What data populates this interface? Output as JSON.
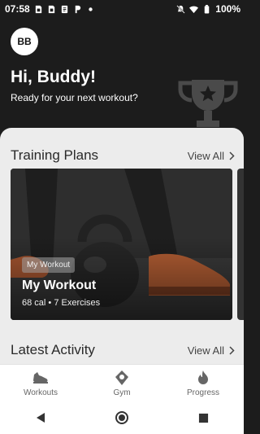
{
  "status_bar": {
    "time": "07:58",
    "battery": "100%",
    "left_icons": [
      "sim-icon",
      "sim-icon",
      "message-icon",
      "parking-icon",
      "dot-icon"
    ],
    "right_icons": [
      "mute-icon",
      "wifi-icon",
      "battery-icon"
    ]
  },
  "header": {
    "avatar_initials": "BB",
    "greeting": "Hi, Buddy!",
    "subtitle": "Ready for your next workout?",
    "decor_icon": "trophy-icon"
  },
  "training_plans": {
    "title": "Training Plans",
    "view_all": "View All",
    "cards": [
      {
        "badge": "My Workout",
        "title": "My Workout",
        "meta": "68 cal • 7 Exercises"
      }
    ]
  },
  "latest_activity": {
    "title": "Latest Activity",
    "view_all": "View All"
  },
  "bottom_nav": {
    "items": [
      {
        "label": "Workouts",
        "icon": "sneaker-icon"
      },
      {
        "label": "Gym",
        "icon": "location-icon"
      },
      {
        "label": "Progress",
        "icon": "flame-icon"
      }
    ]
  },
  "system_nav": [
    "back-icon",
    "home-icon",
    "recents-icon"
  ],
  "colors": {
    "background": "#1c1c1c",
    "panel": "#ececec",
    "accent_card": "#c96a3a",
    "nav_icon": "#666666"
  }
}
